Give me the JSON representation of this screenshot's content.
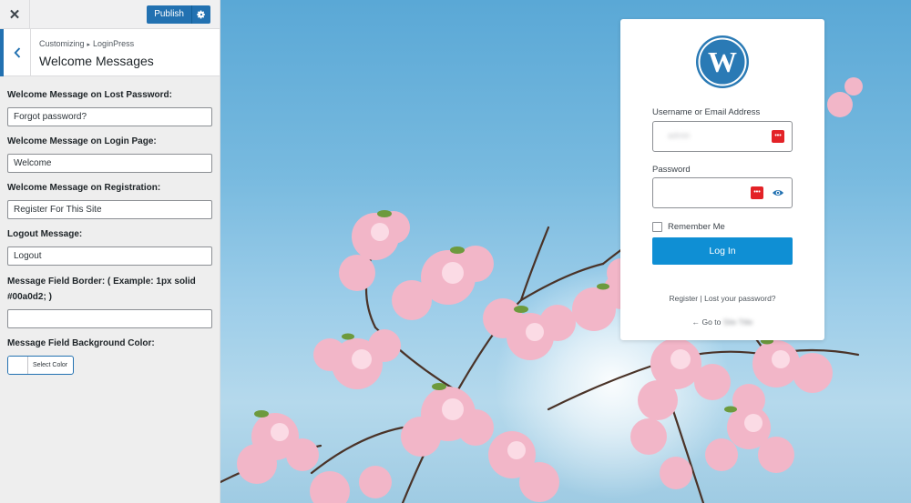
{
  "topbar": {
    "close_glyph": "✕",
    "publish_label": "Publish"
  },
  "section": {
    "breadcrumb_root": "Customizing",
    "breadcrumb_sep": "▸",
    "breadcrumb_leaf": "LoginPress",
    "title": "Welcome Messages"
  },
  "controls": [
    {
      "label": "Welcome Message on Lost Password:",
      "value": "Forgot password?"
    },
    {
      "label": "Welcome Message on Login Page:",
      "value": "Welcome"
    },
    {
      "label": "Welcome Message on Registration:",
      "value": "Register For This Site"
    },
    {
      "label": "Logout Message:",
      "value": "Logout"
    },
    {
      "label": "Message Field Border: ( Example: 1px solid #00a0d2; )",
      "value": ""
    },
    {
      "label": "Message Field Background Color:",
      "button": "Select Color"
    }
  ],
  "login": {
    "username_label": "Username or Email Address",
    "username_value": "admin",
    "password_label": "Password",
    "pw_manager_glyph": "•••",
    "remember_label": "Remember Me",
    "login_button": "Log In",
    "register_link": "Register",
    "links_sep": "|",
    "lost_password_link": "Lost your password?",
    "goto_prefix": "← Go to",
    "goto_site": "Site Title"
  },
  "colors": {
    "accent": "#2271b1",
    "login_button": "#0f8fd4",
    "pw_manager": "#e32227",
    "wp_logo": "#2a7ab5"
  }
}
